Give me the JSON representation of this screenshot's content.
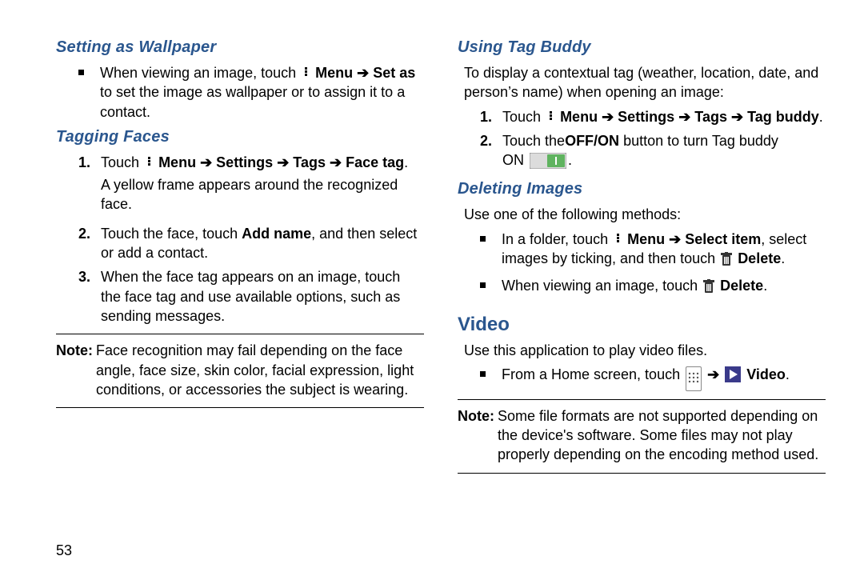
{
  "pageNumber": "53",
  "left": {
    "h1": "Setting as Wallpaper",
    "bullet1_pre": "When viewing an image, touch ",
    "bullet1_menu": "Menu",
    "bullet1_setas": "Set as",
    "bullet1_post": " to set the image as wallpaper or to assign it to a contact.",
    "h2": "Tagging Faces",
    "n1_pre": "Touch ",
    "n1_menu": "Menu",
    "n1_settings": "Settings",
    "n1_tags": "Tags",
    "n1_facetag": "Face tag",
    "n1_post": ".",
    "n1_line2": "A yellow frame appears around the recognized face.",
    "n2_a": "Touch the face, touch ",
    "n2_addname": "Add name",
    "n2_b": ", and then select or add a contact.",
    "n3": "When the face tag appears on an image, touch the face tag and use available options, such as sending messages.",
    "note_label": "Note:",
    "note_body": "Face recognition may fail depending on the face angle, face size, skin color, facial expression, light conditions, or accessories the subject is wearing."
  },
  "right": {
    "h1": "Using Tag Buddy",
    "intro": "To display a contextual tag (weather, location, date, and person’s name) when opening an image:",
    "n1_pre": "Touch ",
    "n1_menu": "Menu",
    "n1_settings": "Settings",
    "n1_tags": "Tags",
    "n1_tagbuddy": "Tag buddy",
    "n1_post": ".",
    "n2_a": "Touch the",
    "n2_offon": "OFF/ON",
    "n2_b": "  button to turn Tag buddy ",
    "n2_on": "ON ",
    "n2_post": ".",
    "h2": "Deleting Images",
    "del_intro": "Use one of the following methods:",
    "db1_a": "In a folder, touch ",
    "db1_menu": "Menu",
    "db1_select": "Select item",
    "db1_b": ", select images by ticking, and then touch ",
    "db1_delete": "Delete",
    "db1_post": ".",
    "db2_a": "When viewing an image, touch ",
    "db2_delete": "Delete",
    "db2_post": ".",
    "video_head": "Video",
    "video_intro": "Use this application to play video files.",
    "vb_a": "From a Home screen, touch ",
    "vb_video": "Video",
    "vb_post": ".",
    "vnote_label": "Note:",
    "vnote_body": "Some file formats are not supported depending on the device's software. Some files may not play properly depending on the encoding method used."
  }
}
